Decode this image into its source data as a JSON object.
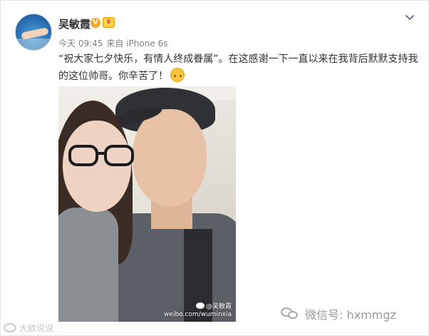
{
  "post": {
    "username": "吴敏霞",
    "verified_icon": "verified-v-icon",
    "verified_symbol": "V",
    "level_icon": "member-badge-icon",
    "level_symbol": "♛",
    "time": "今天 09:45",
    "source": "来自 iPhone 6s",
    "text_line1": "“祝大家七夕快乐，有情人终成眷属”。在这感谢一下一直以来在我背后默默支持我",
    "text_line2": "的这位帅哥。你辛苦了！",
    "emoji": "hug-emoji",
    "menu_icon": "chevron-down-icon"
  },
  "photo": {
    "watermark_handle": "@吴敏霞",
    "watermark_url": "weibo.com/wuminxia"
  },
  "overlay": {
    "wechat_text": "微信号: hxmmgz",
    "corner_text": "大欧说说"
  },
  "colors": {
    "username": "#333333",
    "meta": "#808080",
    "verified": "#f6a623",
    "wechat_text": "#9a9a9a"
  }
}
